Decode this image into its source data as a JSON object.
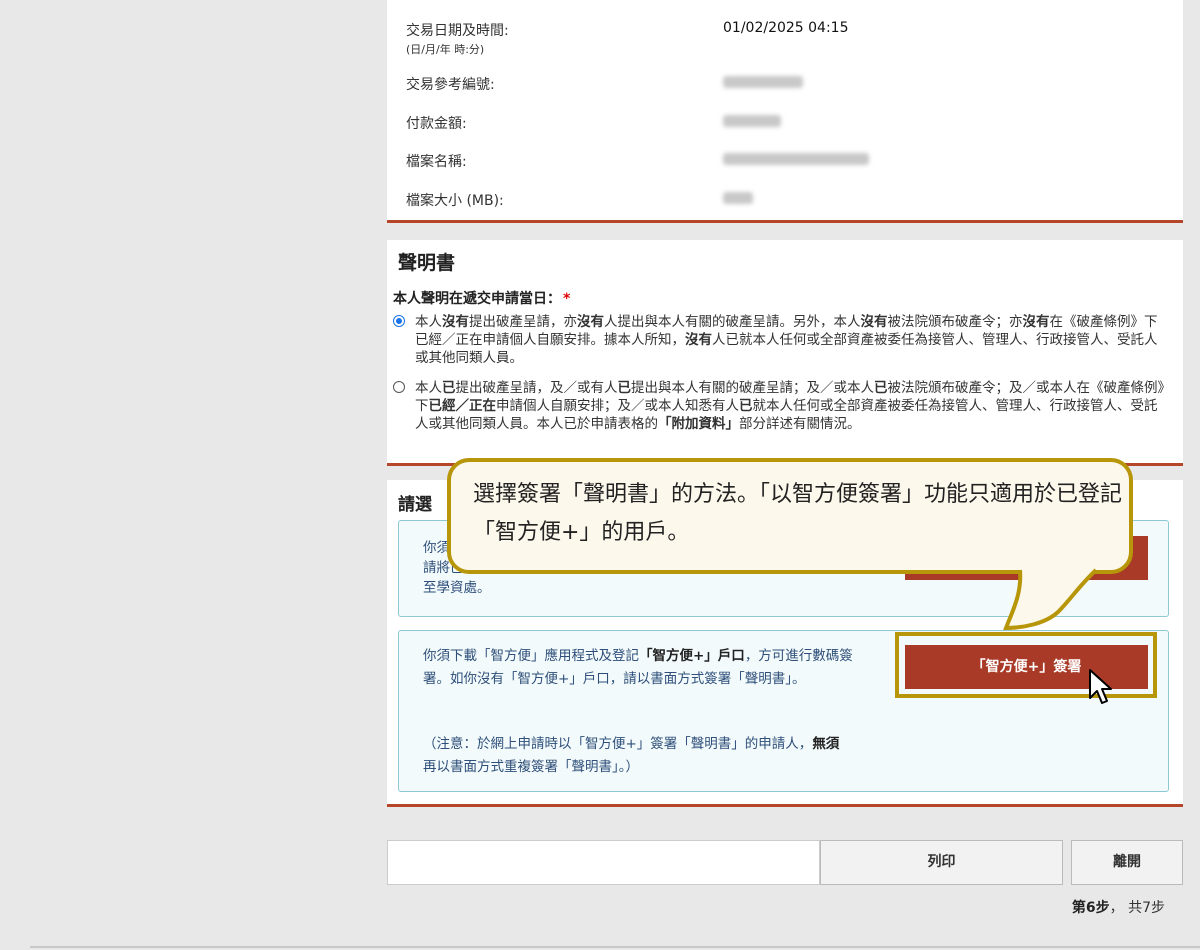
{
  "transaction": {
    "date_label": "交易日期及時間:",
    "date_sub": "(日/月/年 時:分)",
    "date_value": "01/02/2025 04:15",
    "ref_label": "交易參考編號:",
    "amount_label": "付款金額:",
    "file_name_label": "檔案名稱:",
    "file_size_label": "檔案大小 (MB):"
  },
  "declaration": {
    "title": "聲明書",
    "question": "本人聲明在遞交申請當日：",
    "required_mark": "*",
    "option1_selected": true,
    "option1_parts": [
      "本人",
      "沒有",
      "提出破產呈請，亦",
      "沒有",
      "人提出與本人有關的破產呈請。另外，本人",
      "沒有",
      "被法院頒布破產令；亦",
      "沒有",
      "在《破產條例》下已經／正在申請個人自願安排。據本人所知，",
      "沒有",
      "人已就本人任何或全部資產被委任為接管人、管理人、行政接管人、受託人或其他同類人員。"
    ],
    "option2_parts": [
      "本人",
      "已",
      "提出破產呈請，及／或有人",
      "已",
      "提出與本人有關的破產呈請；及／或本人",
      "已",
      "被法院頒布破產令；及／或本人在《破產條例》下",
      "已經／正在",
      "申請個人自願安排；及／或本人知悉有人",
      "已",
      "就本人任何或全部資產被委任為接管人、管理人、行政接管人、受託人或其他同類人員。本人已於申請表格的",
      "「附加資料」",
      "部分詳述有關情況。"
    ]
  },
  "sign": {
    "title": "請選",
    "paper_text_1": "你須",
    "paper_text_2": "請將已簽妥的「聲明書」連同所需證明文件（如適用）一併遞交",
    "paper_text_3": "至學資處。",
    "iamsmart_text_1": "你須下載「智方便」應用程式及登記",
    "iamsmart_text_bold": "「智方便+」戶口",
    "iamsmart_text_2": "，方可進行數碼簽署。如你沒有「智方便+」戶口，請以書面方式簽署「聲明書」。",
    "note_1": "（注意：於網上申請時以「智方便+」簽署「聲明書」的申請人，",
    "note_bold": "無須",
    "note_2": "再以書面方式重複簽署「聲明書」。）",
    "iamsmart_button": "「智方便+」簽署"
  },
  "buttons": {
    "print": "列印",
    "exit": "離開"
  },
  "step": {
    "current": "第6步",
    "sep": "，",
    "total": "共7步"
  },
  "callout": {
    "text": "選擇簽署「聲明書」的方法。「以智方便簽署」功能只適用於已登記「智方便+」的用戶。"
  },
  "colors": {
    "accent": "#b5462a",
    "button_red": "#a83a27",
    "highlight_gold": "#b8960a"
  }
}
